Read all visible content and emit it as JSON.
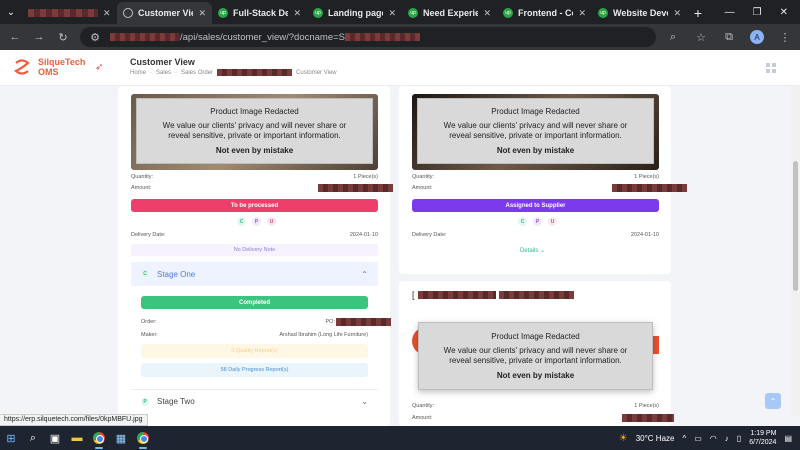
{
  "browser": {
    "tabs": [
      {
        "label": "",
        "redacted": true
      },
      {
        "label": "Customer View",
        "active": true
      },
      {
        "label": "Full-Stack Desig"
      },
      {
        "label": "Landing page in"
      },
      {
        "label": "Need Experienc"
      },
      {
        "label": "Frontend - Com"
      },
      {
        "label": "Website Develop"
      }
    ],
    "url_suffix": "/api/sales/customer_view/?docname=S",
    "status_url": "https://erp.silquetech.com/files/0kpMBFU.jpg",
    "profile_initial": "A"
  },
  "app": {
    "logo_line1": "SilqueTech",
    "logo_line2": "OMS",
    "page_title": "Customer View",
    "breadcrumb": [
      "Home",
      "Sales",
      "Sales Order",
      "Customer View"
    ]
  },
  "placeholder": {
    "heading": "Product Image Redacted",
    "body": "We value our clients' privacy and will never share or reveal sensitive, private or important information.",
    "footer": "Not even by mistake"
  },
  "card_left": {
    "quantity_label": "Quantity:",
    "quantity_value": "1 Piece(s)",
    "amount_label": "Amount:",
    "status_button": "To be processed",
    "chips": [
      "C",
      "P",
      "U"
    ],
    "delivery_label": "Delivery Date:",
    "delivery_value": "2024-01-10",
    "no_delivery_note": "No Delivery Note",
    "stage_one": {
      "bullet": "C",
      "name": "Stage One",
      "status": "Completed",
      "order_label": "Order:",
      "order_value": "PO:",
      "maker_label": "Maker:",
      "maker_value": "Arshad Ibrahim (Long Life Furniture)",
      "quality_reports": "0 Quality Report(s)",
      "progress_reports": "58 Daily Progress Report(s)"
    },
    "stage_two": {
      "bullet": "P",
      "name": "Stage Two"
    }
  },
  "card_right": {
    "quantity_label": "Quantity:",
    "quantity_value": "1 Piece(s)",
    "amount_label": "Amount:",
    "status_button": "Assigned to Supplier",
    "chips": [
      "C",
      "P",
      "U"
    ],
    "delivery_label": "Delivery Date:",
    "delivery_value": "2024-01-10",
    "details_link": "Details"
  },
  "card_right2": {
    "title_prefix": "[",
    "quantity_label": "Quantity:",
    "quantity_value": "1 Piece(s)",
    "amount_label": "Amount:"
  },
  "taskbar": {
    "weather": "30°C  Haze",
    "time": "1:19 PM",
    "date": "6/7/2024"
  },
  "colors": {
    "brand": "#e8603c",
    "to_be_processed": "#ee3e6b",
    "assigned": "#7c3aed",
    "completed": "#3ac47d"
  }
}
